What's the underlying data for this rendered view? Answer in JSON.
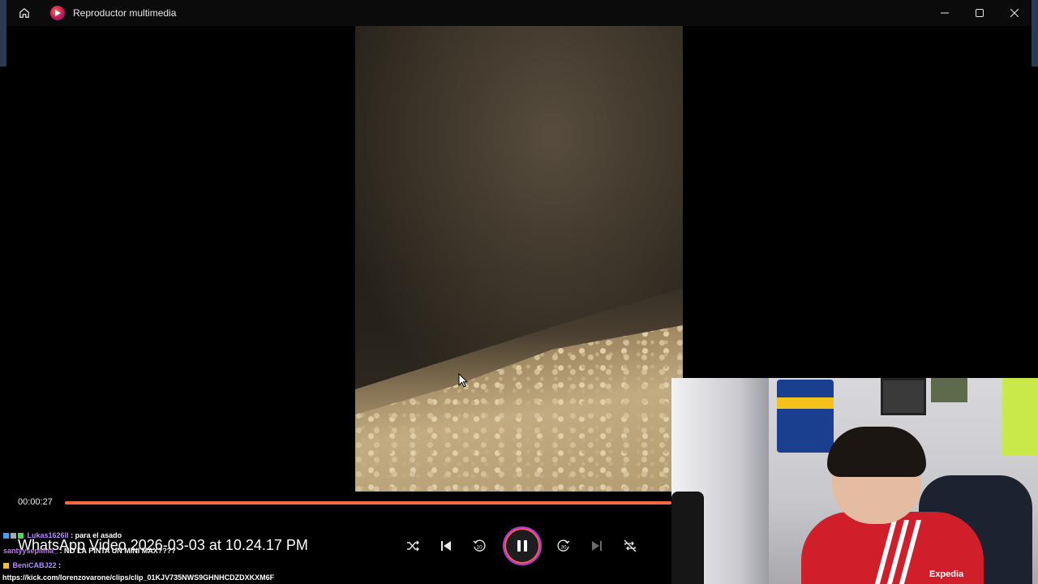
{
  "window": {
    "title": "Reproductor multimedia",
    "accent": "#ff6a3d"
  },
  "icons": {
    "home": "home-icon",
    "app": "media-player-icon",
    "minimize": "minimize-icon",
    "maximize": "maximize-icon",
    "close": "close-icon"
  },
  "player": {
    "current_time": "00:00:27",
    "progress": 1.0,
    "video_name": "WhatsApp Video 2026-03-03 at 10.24.17 PM",
    "controls": [
      "shuffle-icon",
      "previous-icon",
      "rewind-10-icon",
      "pause-icon",
      "forward-30-icon",
      "next-icon",
      "repeat-off-icon"
    ]
  },
  "chat": {
    "messages": [
      {
        "user": "Lukas1626ll",
        "text": ": para el asado"
      },
      {
        "user": "santyysepilma_",
        "text": ": NO LA PINTA UN MINI MAX????"
      },
      {
        "user": "BeniCABJ22",
        "text": ":"
      }
    ],
    "clip_url": "https://kick.com/lorenzovarone/clips/clip_01KJV735NWS9GHNHCDZDXKXM6F"
  },
  "webcam": {
    "sponsor": "Expedia"
  }
}
